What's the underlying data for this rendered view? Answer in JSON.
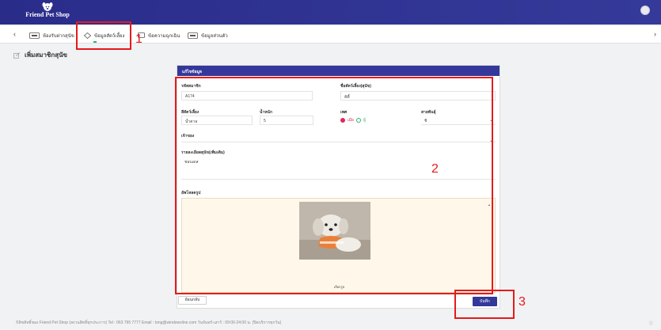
{
  "app": {
    "logo_text": "Friend Pet Shop"
  },
  "tabs": [
    {
      "label": "ห้องรับฝากสุนัข"
    },
    {
      "label": "ข้อมูลสัตว์เลี้ยง"
    },
    {
      "label": "ข้อความฉุกเฉิน"
    },
    {
      "label": "ข้อมูลส่วนตัว"
    }
  ],
  "page_title": "เพิ่มสมาชิกสุนัข",
  "form": {
    "header": "แก้ไขข้อมูล",
    "member_id_label": "รหัสสมาชิก",
    "member_id_value": "A174",
    "pet_name_label": "ชื่อสัตว์เลี้ยง(สุนัข)",
    "pet_name_value": "คิตี้",
    "pet_color_label": "สีสัตว์เลี้ยง",
    "pet_color_value": "น้ำตาล",
    "weight_label": "น้ำหนัก",
    "weight_value": "5",
    "sex_label": "เพศ",
    "sex_female": "เมีย",
    "sex_male": "ผู้",
    "breed_label": "สายพันธุ์",
    "breed_value": "ชิ",
    "owner_label": "เจ้าของ",
    "details_label": "รายละเอียดสุนัข(เพิ่มเติม)",
    "details_value": "ชอบเดส",
    "image_label": "อัพโหลดรูป",
    "upload_link": "เลือกรูป"
  },
  "buttons": {
    "back": "ย้อนกลับ",
    "save": "บันทึก"
  },
  "annotations": [
    "1",
    "2",
    "3"
  ],
  "footer": "©ลิขสิทธิ์ของ Friend Pet Shop (สงวนสิทธิ์ทุกประการ) Tel : 063 795 7777   Email : tong@windowsline.com   วันจันทร์-เสาร์ : 09:00-24:00 น. (ปิดบริการทุกวัน)",
  "colors": {
    "primary": "#33389a",
    "annotation": "#e41b1b",
    "female": "#e2275f",
    "male": "#2db36a"
  }
}
